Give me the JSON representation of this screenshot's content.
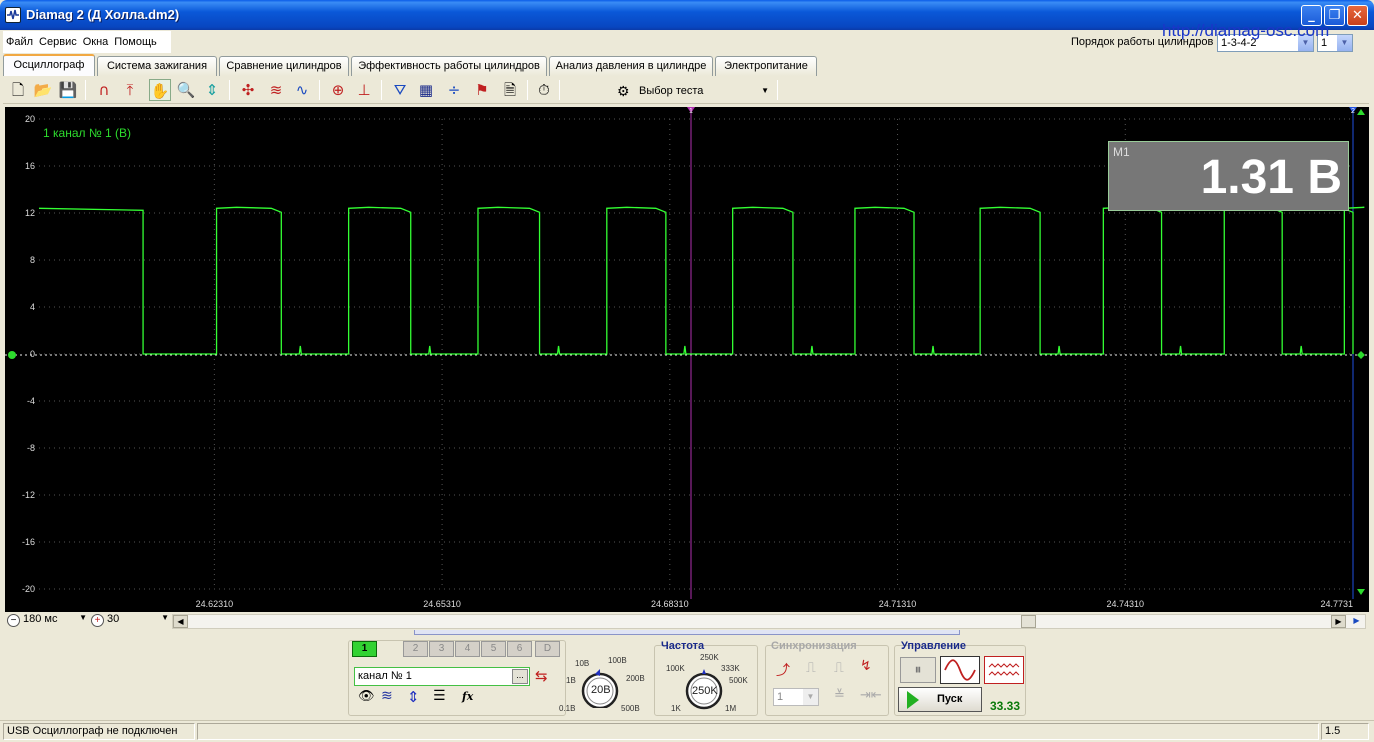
{
  "window": {
    "title": "Diamag 2 (Д Холла.dm2)"
  },
  "menu": [
    "Файл",
    "Сервис",
    "Окна",
    "Помощь"
  ],
  "header": {
    "url": "http://diamag-osc.com",
    "order_label": "Порядок работы цилиндров",
    "order_value": "1-3-4-2",
    "cylinder_value": "1"
  },
  "tabs": [
    "Осциллограф",
    "Система зажигания",
    "Сравнение цилиндров",
    "Эффективность работы цилиндров",
    "Анализ давления в цилиндре",
    "Электропитание"
  ],
  "toolbar": {
    "test_select_label": "Выбор теста"
  },
  "scope": {
    "channel_label": "1 канал № 1 (В)",
    "marker1": "1",
    "marker2": "2",
    "measurement_label": "M1",
    "measurement_value": "1.31 В",
    "y_ticks": [
      "20",
      "16",
      "12",
      "8",
      "4",
      "0",
      "-4",
      "-8",
      "-12",
      "-16",
      "-20"
    ],
    "x_ticks": [
      "24.62310",
      "24.65310",
      "24.68310",
      "24.71310",
      "24.74310",
      "24.7731"
    ],
    "trace_color": "#33ff33",
    "ylim": [
      -20,
      20
    ],
    "xlim": [
      24.6,
      24.7731
    ],
    "low_level": 0,
    "high_level": 12.4,
    "pulses": [
      [
        24.60572,
        24.61371
      ],
      [
        24.62339,
        24.63192
      ],
      [
        24.64079,
        24.64897
      ],
      [
        24.65783,
        24.66594
      ],
      [
        24.6748,
        24.68258
      ],
      [
        24.69138,
        24.69932
      ],
      [
        24.70749,
        24.71527
      ],
      [
        24.72398,
        24.73188
      ],
      [
        24.74021,
        24.74788
      ],
      [
        24.75614,
        24.76377
      ],
      [
        24.77196,
        24.7731
      ]
    ]
  },
  "bottom": {
    "time_value": "180 мс",
    "count_value": "30"
  },
  "channels": {
    "buttons": [
      "1",
      "2",
      "3",
      "4",
      "5",
      "6",
      "D"
    ],
    "name_value": "канал № 1",
    "browse_label": "..."
  },
  "voltage_knob": {
    "labels": [
      "10В",
      "100В",
      "1В",
      "200В",
      "0.1В",
      "500В"
    ],
    "value": "20В"
  },
  "frequency": {
    "title": "Частота",
    "labels": [
      "250K",
      "100K",
      "333K",
      "500K",
      "1K",
      "1M"
    ],
    "value": "250K"
  },
  "sync": {
    "title": "Синхронизация",
    "channel_value": "1"
  },
  "control": {
    "title": "Управление",
    "run_label": "Пуск",
    "counter": "33.33"
  },
  "status": {
    "message": "USB Осциллограф не подключен",
    "right": "1.5"
  }
}
